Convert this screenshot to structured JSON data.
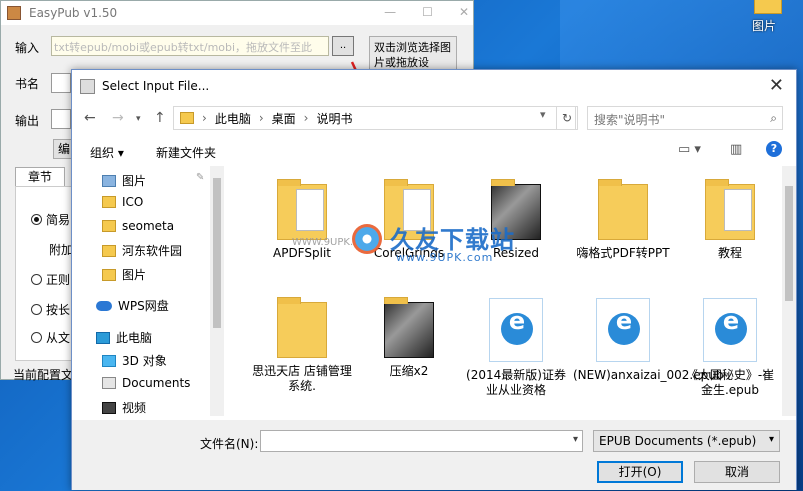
{
  "desktop": {
    "icon_label": "图片"
  },
  "easypub": {
    "title": "EasyPub v1.50",
    "labels": {
      "input": "输入",
      "book_name": "书名",
      "output": "输出"
    },
    "input_placeholder": "txt转epub/mobi或epub转txt/mobi，拖放文件至此",
    "browse_label": "..",
    "drop_hint": "双击浏览选择图片或拖放设",
    "edit_button": "编",
    "tab_chapter": "章节",
    "options": [
      "简易",
      "附加",
      "正则",
      "按长",
      "从文"
    ],
    "status": "当前配置文"
  },
  "dialog": {
    "title": "Select Input File...",
    "breadcrumb": [
      "此电脑",
      "桌面",
      "说明书"
    ],
    "search_placeholder": "搜索\"说明书\"",
    "toolbar": {
      "organize": "组织 ▾",
      "new_folder": "新建文件夹"
    },
    "help": "?",
    "nav_items": [
      "图片",
      "ICO",
      "seometa",
      "河东软件园",
      "图片",
      "WPS网盘",
      "此电脑",
      "3D 对象",
      "Documents",
      "视频"
    ],
    "files_row1": [
      "APDFSplit",
      "CorelGrinds",
      "Resized",
      "嗨格式PDF转PPT",
      "教程"
    ],
    "files_row2": [
      "思迅天店 店铺管理系统.",
      "压缩x2",
      "(2014最新版)证券业从业资格",
      "(NEW)anxaizai_002.epub",
      "《大国秘史》-崔金生.epub"
    ],
    "watermark": {
      "brand": "久友下载站",
      "url": "www.9UPK.com",
      "left": "WWW.9UPK.COM"
    },
    "filename_label": "文件名(N):",
    "filename_value": "",
    "file_type": "EPUB Documents (*.epub)",
    "open_button": "打开(O)",
    "cancel_button": "取消"
  },
  "colors": {
    "accent": "#0078d7",
    "folder": "#f6cc5a",
    "epub": "#2a8bd8",
    "arrow": "#e02020"
  }
}
